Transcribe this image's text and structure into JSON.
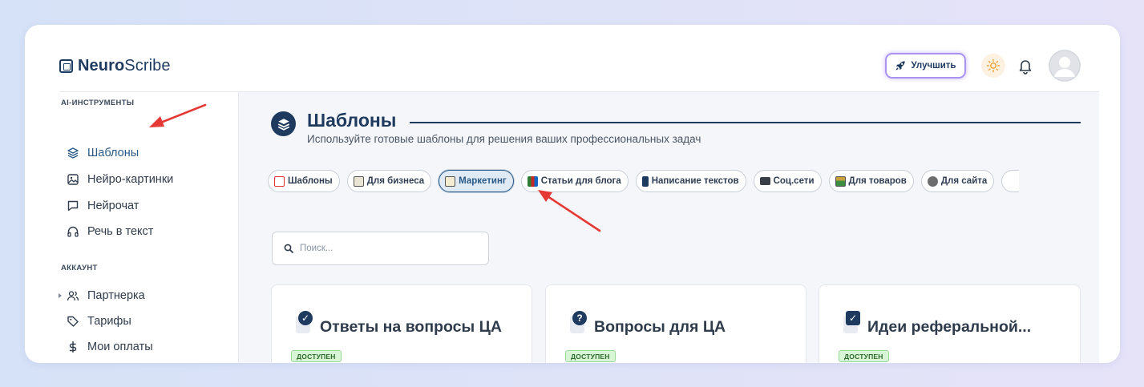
{
  "app": {
    "logo_bold": "Neuro",
    "logo_regular": "Scribe"
  },
  "header": {
    "upgrade_label": "Улучшить"
  },
  "sidebar": {
    "sections": [
      {
        "title": "AI-ИНСТРУМЕНТЫ",
        "items": [
          {
            "label": "Шаблоны",
            "icon": "layers-icon",
            "active": true
          },
          {
            "label": "Нейро-картинки",
            "icon": "image-icon"
          },
          {
            "label": "Нейрочат",
            "icon": "chat-icon"
          },
          {
            "label": "Речь в текст",
            "icon": "headphones-icon"
          }
        ]
      },
      {
        "title": "АККАУНТ",
        "items": [
          {
            "label": "Партнерка",
            "icon": "users-icon",
            "expandable": true
          },
          {
            "label": "Тарифы",
            "icon": "tag-icon"
          },
          {
            "label": "Мои оплаты",
            "icon": "dollar-icon"
          }
        ]
      }
    ]
  },
  "main": {
    "title": "Шаблоны",
    "subtitle": "Используйте готовые шаблоны для решения ваших профессиональных задач",
    "tabs": [
      {
        "label": "Шаблоны",
        "icon": "chart-emoji",
        "active": false
      },
      {
        "label": "Для бизнеса",
        "icon": "ledger-emoji",
        "active": false
      },
      {
        "label": "Маркетинг",
        "icon": "memo-emoji",
        "active": true
      },
      {
        "label": "Статьи для блога",
        "icon": "books-emoji",
        "active": false
      },
      {
        "label": "Написание текстов",
        "icon": "phone-emoji",
        "active": false
      },
      {
        "label": "Соц.сети",
        "icon": "laptop-emoji",
        "active": false
      },
      {
        "label": "Для товаров",
        "icon": "ledger-emoji",
        "active": false
      },
      {
        "label": "Для сайта",
        "icon": "robot-emoji",
        "active": false
      }
    ],
    "search": {
      "placeholder": "Поиск..."
    },
    "cards": [
      {
        "title": "Ответы на вопросы ЦА",
        "badge": "ДОСТУПЕН",
        "icon": "check-circle-icon"
      },
      {
        "title": "Вопросы для ЦА",
        "badge": "ДОСТУПЕН",
        "icon": "question-circle-icon"
      },
      {
        "title": "Идеи реферальной...",
        "badge": "ДОСТУПЕН",
        "icon": "check-box-icon"
      }
    ]
  },
  "colors": {
    "brand": "#1e3a5f",
    "accent": "#2b5a86",
    "annotation": "#e53935",
    "badge_bg": "#d8f5d6"
  }
}
